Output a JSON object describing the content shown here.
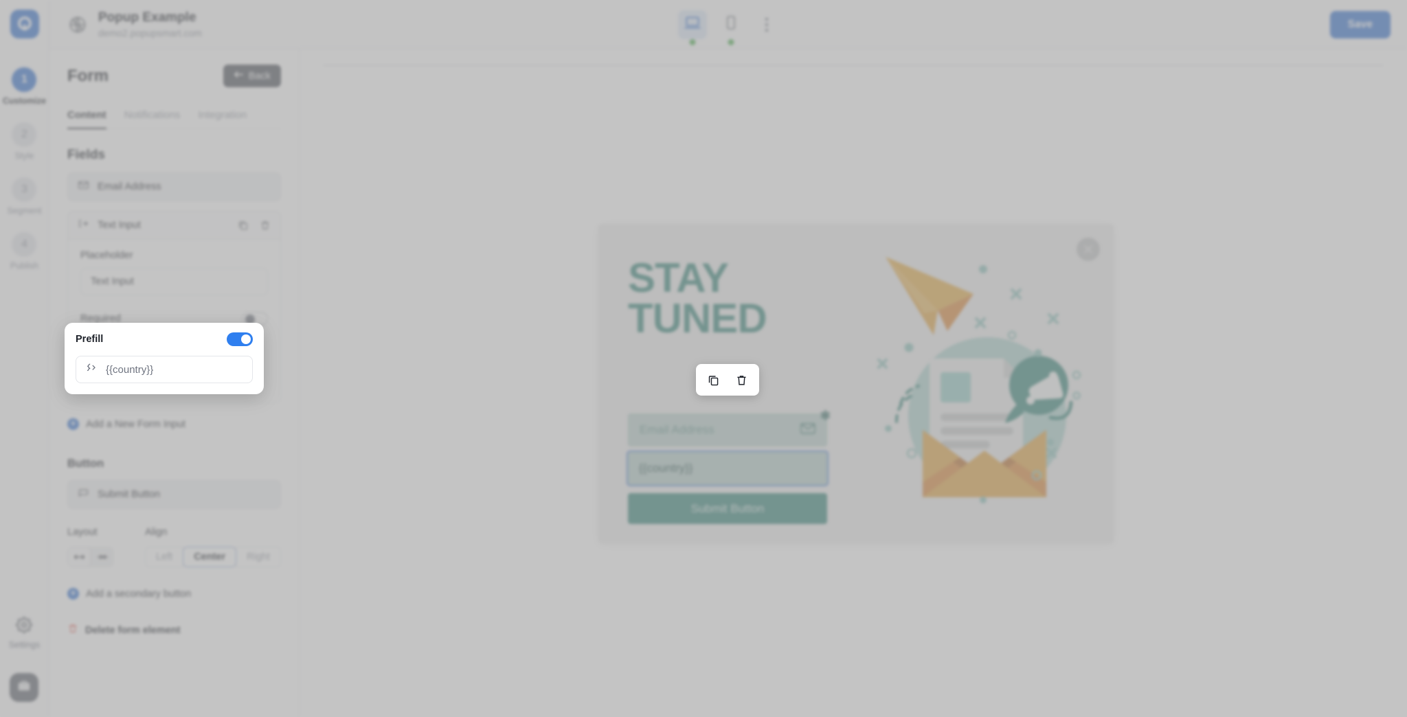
{
  "app": {
    "logo_icon": "popupsmart-logo-icon"
  },
  "header": {
    "globe_icon": "globe-slash-icon",
    "title": "Popup Example",
    "subtitle": "demo2.popupsmart.com",
    "devices": [
      {
        "icon": "desktop-icon",
        "name": "desktop",
        "active": true,
        "status_dot": "green"
      },
      {
        "icon": "mobile-icon",
        "name": "mobile",
        "active": false,
        "status_dot": "green"
      }
    ],
    "more_icon": "kebab-menu-icon",
    "save_label": "Save"
  },
  "rail": {
    "steps": [
      {
        "number": "1",
        "label": "Customize",
        "active": true
      },
      {
        "number": "2",
        "label": "Style",
        "active": false
      },
      {
        "number": "3",
        "label": "Segment",
        "active": false
      },
      {
        "number": "4",
        "label": "Publish",
        "active": false
      }
    ],
    "settings_label": "Settings",
    "settings_icon": "gear-icon",
    "avatar_icon": "briefcase-icon"
  },
  "panel": {
    "title": "Form",
    "back_label": "Back",
    "back_icon": "arrow-left-icon",
    "tabs": [
      {
        "label": "Content",
        "active": true
      },
      {
        "label": "Notifications",
        "active": false
      },
      {
        "label": "Integration",
        "active": false
      }
    ],
    "fields_section_title": "Fields",
    "fields": [
      {
        "label": "Email Address",
        "icon": "envelope-icon",
        "selected": false
      },
      {
        "label": "Text Input",
        "icon": "text-input-icon",
        "selected": true
      }
    ],
    "row_actions": {
      "copy_icon": "copy-icon",
      "delete_icon": "trash-icon"
    },
    "placeholder_label": "Placeholder",
    "placeholder_value": "Text Input",
    "placeholder_input_placeholder": "Text Input",
    "required_label": "Required",
    "required_on": false,
    "add_input_label": "Add a New Form Input",
    "button_section_title": "Button",
    "submit_button_row_label": "Submit Button",
    "submit_button_icon": "button-icon",
    "layout_label": "Layout",
    "layout_options": [
      {
        "icon": "stretch-width-icon",
        "selected": true
      },
      {
        "icon": "fit-content-icon",
        "selected": false
      }
    ],
    "align_label": "Align",
    "align_options": [
      {
        "label": "Left",
        "selected": false
      },
      {
        "label": "Center",
        "selected": true
      },
      {
        "label": "Right",
        "selected": false
      }
    ],
    "add_secondary_label": "Add a secondary button",
    "delete_form_label": "Delete form element",
    "delete_form_icon": "trash-icon"
  },
  "prefill_popover": {
    "label": "Prefill",
    "toggle_on": true,
    "token_icon": "code-braces-icon",
    "token_value": "{{country}}"
  },
  "hover_toolbar": {
    "copy_icon": "copy-icon",
    "delete_icon": "trash-icon"
  },
  "preview": {
    "close_icon": "close-icon",
    "headline_line1": "STAY",
    "headline_line2": "TUNED",
    "email_placeholder": "Email Address",
    "email_icon": "envelope-icon",
    "email_required_marker": "✻",
    "text_input_value": "{{country}}",
    "submit_label": "Submit Button",
    "illustration_name": "newsletter-envelope-illustration",
    "colors": {
      "accent_green": "#2e8074",
      "accent_orange": "#e0a03a",
      "selection_blue": "#4b7fd4",
      "popup_bg": "#ececec"
    }
  },
  "chat": {
    "icon": "chat-bubble-icon"
  },
  "theme": {
    "brand_blue": "#2f6fd0",
    "toggle_on_blue": "#2f7fef",
    "text_dark": "#1d2129",
    "text_muted": "#8a8f9a"
  }
}
